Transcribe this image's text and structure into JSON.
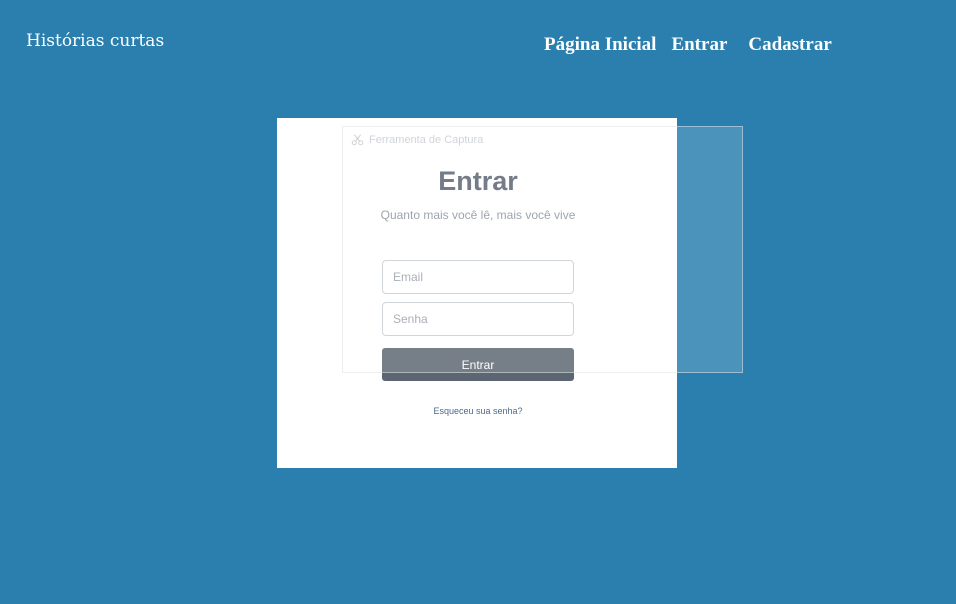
{
  "header": {
    "brand": "Histórias curtas",
    "nav": [
      {
        "label": "Página Inicial"
      },
      {
        "label": "Entrar"
      },
      {
        "label": "Cadastrar"
      }
    ]
  },
  "login": {
    "title": "Entrar",
    "subtitle": "Quanto mais você lê, mais você vive",
    "email_placeholder": "Email",
    "password_placeholder": "Senha",
    "submit_label": "Entrar",
    "forgot_label": "Esqueceu sua senha?"
  },
  "overlay": {
    "title": "Ferramenta de Captura",
    "icon": "scissors-icon"
  },
  "colors": {
    "background": "#2a7fae",
    "card": "#ffffff",
    "button": "#5c6672",
    "title": "#5a6472"
  }
}
